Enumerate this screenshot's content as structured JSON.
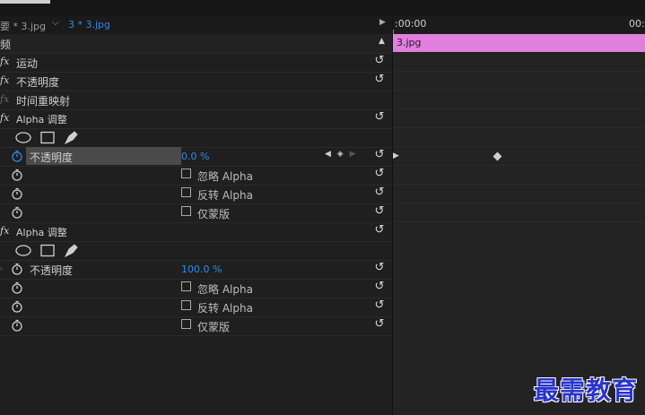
{
  "tabs": {
    "tab1": "要 * 3.jpg",
    "tab2": "3 * 3.jpg"
  },
  "section_header": "频",
  "effects": {
    "motion": "运动",
    "opacity": "不透明度",
    "time_remap": "时间重映射",
    "alpha_adjust_1": "Alpha 调整",
    "alpha_adjust_2": "Alpha 调整"
  },
  "alpha1": {
    "opacity_label": "不透明度",
    "opacity_value": "0.0 %",
    "ignore_alpha": "忽略 Alpha",
    "invert_alpha": "反转 Alpha",
    "mask_only": "仅蒙版"
  },
  "alpha2": {
    "opacity_label": "不透明度",
    "opacity_value": "100.0 %",
    "ignore_alpha": "忽略 Alpha",
    "invert_alpha": "反转 Alpha",
    "mask_only": "仅蒙版"
  },
  "timeline": {
    "time_start": ":00:00",
    "time_end": "00:",
    "clip_name": "3.jpg"
  },
  "watermark": "最需教育",
  "colors": {
    "accent": "#2d8ceb",
    "clip": "#e07fdc"
  }
}
